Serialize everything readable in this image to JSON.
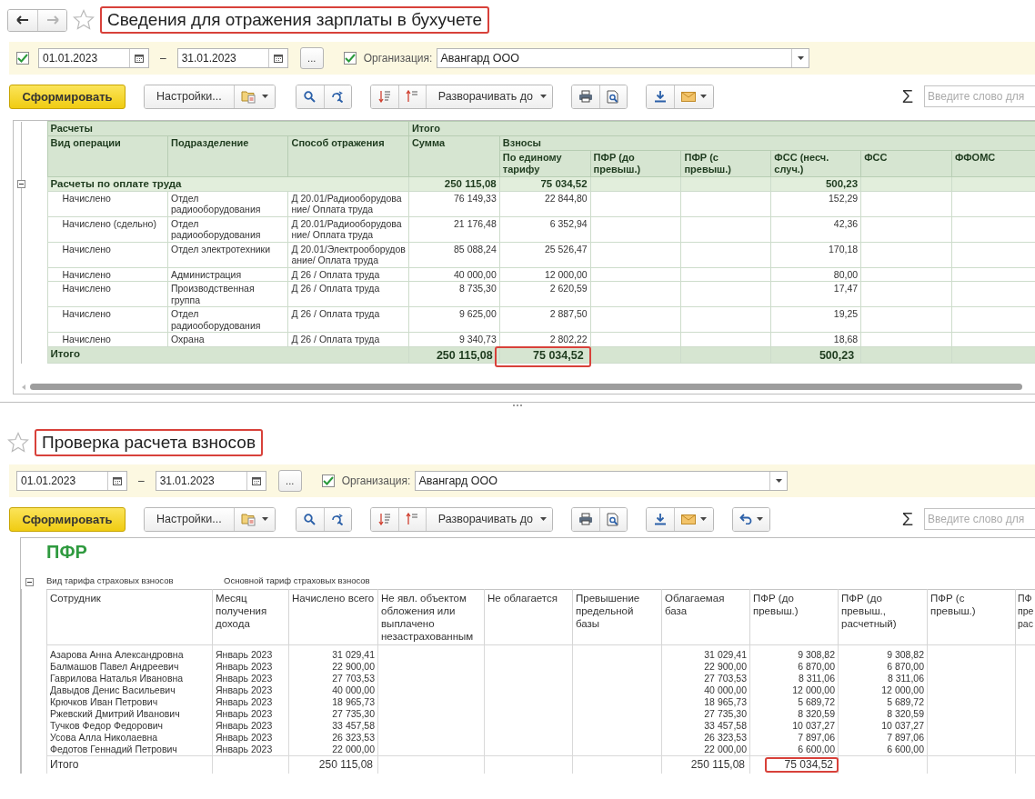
{
  "panels": [
    {
      "nav": {
        "back_disabled": false,
        "forward_disabled": true
      },
      "title": "Сведения для отражения зарплаты в бухучете",
      "title_highlighted": true,
      "filters": {
        "period_checked": true,
        "date_from": "01.01.2023",
        "dash": "–",
        "date_to": "31.01.2023",
        "more": "...",
        "org_checked": true,
        "org_label": "Организация:",
        "org_value": "Авангард ООО"
      },
      "toolbar": {
        "generate": "Сформировать",
        "settings": "Настройки...",
        "expand": "Разворачивать до",
        "sum": "Σ",
        "search_placeholder": "Введите слово для"
      },
      "table": {
        "kind": "ledger",
        "group_header": [
          "Расчеты",
          "Итого"
        ],
        "sub_header": [
          "Вид операции",
          "Подразделение",
          "Способ отражения",
          "Сумма",
          "Взносы"
        ],
        "fee_columns": [
          "По единому тарифу",
          "ПФР (до превыш.)",
          "ПФР (с превыш.)",
          "ФСС (несч. случ.)",
          "ФСС",
          "ФФОМС"
        ],
        "groups": [
          {
            "label": "Расчеты по оплате труда",
            "expanded": true,
            "sum": "250 115,08",
            "single_tariff": "75 034,52",
            "fss_accident": "500,23",
            "rows": [
              {
                "operation": "Начислено",
                "department": "Отдел радиооборудования",
                "account": "Д 20.01/Радиооборудование/ Оплата труда",
                "sum": "76 149,33",
                "single_tariff": "22 844,80",
                "fss_accident": "152,29"
              },
              {
                "operation": "Начислено (сдельно)",
                "department": "Отдел радиооборудования",
                "account": "Д 20.01/Радиооборудование/ Оплата труда",
                "sum": "21 176,48",
                "single_tariff": "6 352,94",
                "fss_accident": "42,36"
              },
              {
                "operation": "Начислено",
                "department": "Отдел электротехники",
                "account": "Д 20.01/Электрооборудование/ Оплата труда",
                "sum": "85 088,24",
                "single_tariff": "25 526,47",
                "fss_accident": "170,18"
              },
              {
                "operation": "Начислено",
                "department": "Администрация",
                "account": "Д 26 / Оплата труда",
                "sum": "40 000,00",
                "single_tariff": "12 000,00",
                "fss_accident": "80,00"
              },
              {
                "operation": "Начислено",
                "department": "Производственная группа",
                "account": "Д 26 / Оплата труда",
                "sum": "8 735,30",
                "single_tariff": "2 620,59",
                "fss_accident": "17,47"
              },
              {
                "operation": "Начислено",
                "department": "Отдел радиооборудования",
                "account": "Д 26 / Оплата труда",
                "sum": "9 625,00",
                "single_tariff": "2 887,50",
                "fss_accident": "19,25"
              },
              {
                "operation": "Начислено",
                "department": "Охрана",
                "account": "Д 26 / Оплата труда",
                "sum": "9 340,73",
                "single_tariff": "2 802,22",
                "fss_accident": "18,68"
              }
            ]
          }
        ],
        "total": {
          "label": "Итого",
          "sum": {
            "value": "250 115,08",
            "highlighted": false
          },
          "single_tariff": {
            "value": "75 034,52",
            "highlighted": true
          },
          "fss_accident": {
            "value": "500,23",
            "highlighted": false
          }
        }
      }
    },
    {
      "title": "Проверка расчета взносов",
      "title_highlighted": true,
      "filters": {
        "date_from": "01.01.2023",
        "dash": "–",
        "date_to": "31.01.2023",
        "more": "...",
        "org_checked": true,
        "org_label": "Организация:",
        "org_value": "Авангард ООО"
      },
      "toolbar": {
        "generate": "Сформировать",
        "settings": "Настройки...",
        "expand": "Разворачивать до",
        "return_button": true,
        "sum": "Σ",
        "search_placeholder": "Введите слово для"
      },
      "table": {
        "kind": "contributions",
        "heading": "ПФР",
        "expanded": true,
        "tariff_label": "Вид тарифа страховых взносов",
        "tariff_value": "Основной тариф страховых взносов",
        "columns": [
          "Сотрудник",
          "Месяц получения дохода",
          "Начислено всего",
          "Не явл. объектом обложения или выплачено незастрахованным",
          "Не облагается",
          "Превышение предельной базы",
          "Облагаемая база",
          "ПФР (до превыш.)",
          "ПФР (до превыш., расчетный)",
          "ПФР (с превыш.)",
          "ПФ пре рас"
        ],
        "rows": [
          {
            "employee": "Азарова Анна Александровна",
            "month": "Январь 2023",
            "accrued": "31 029,41",
            "taxable_base": "31 029,41",
            "pfr_below": "9 308,82",
            "pfr_below_calc": "9 308,82"
          },
          {
            "employee": "Балмашов Павел Андреевич",
            "month": "Январь 2023",
            "accrued": "22 900,00",
            "taxable_base": "22 900,00",
            "pfr_below": "6 870,00",
            "pfr_below_calc": "6 870,00"
          },
          {
            "employee": "Гаврилова Наталья Ивановна",
            "month": "Январь 2023",
            "accrued": "27 703,53",
            "taxable_base": "27 703,53",
            "pfr_below": "8 311,06",
            "pfr_below_calc": "8 311,06"
          },
          {
            "employee": "Давыдов Денис Васильевич",
            "month": "Январь 2023",
            "accrued": "40 000,00",
            "taxable_base": "40 000,00",
            "pfr_below": "12 000,00",
            "pfr_below_calc": "12 000,00"
          },
          {
            "employee": "Крючков Иван Петрович",
            "month": "Январь 2023",
            "accrued": "18 965,73",
            "taxable_base": "18 965,73",
            "pfr_below": "5 689,72",
            "pfr_below_calc": "5 689,72"
          },
          {
            "employee": "Ржевский Дмитрий Иванович",
            "month": "Январь 2023",
            "accrued": "27 735,30",
            "taxable_base": "27 735,30",
            "pfr_below": "8 320,59",
            "pfr_below_calc": "8 320,59"
          },
          {
            "employee": "Тучков Федор Федорович",
            "month": "Январь 2023",
            "accrued": "33 457,58",
            "taxable_base": "33 457,58",
            "pfr_below": "10 037,27",
            "pfr_below_calc": "10 037,27"
          },
          {
            "employee": "Усова Алла Николаевна",
            "month": "Январь 2023",
            "accrued": "26 323,53",
            "taxable_base": "26 323,53",
            "pfr_below": "7 897,06",
            "pfr_below_calc": "7 897,06"
          },
          {
            "employee": "Федотов Геннадий Петрович",
            "month": "Январь 2023",
            "accrued": "22 000,00",
            "taxable_base": "22 000,00",
            "pfr_below": "6 600,00",
            "pfr_below_calc": "6 600,00"
          }
        ],
        "total": {
          "label": "Итого",
          "accrued": {
            "value": "250 115,08",
            "highlighted": false
          },
          "taxable_base": {
            "value": "250 115,08",
            "highlighted": false
          },
          "pfr_below": {
            "value": "75 034,52",
            "highlighted": true
          }
        }
      }
    }
  ]
}
